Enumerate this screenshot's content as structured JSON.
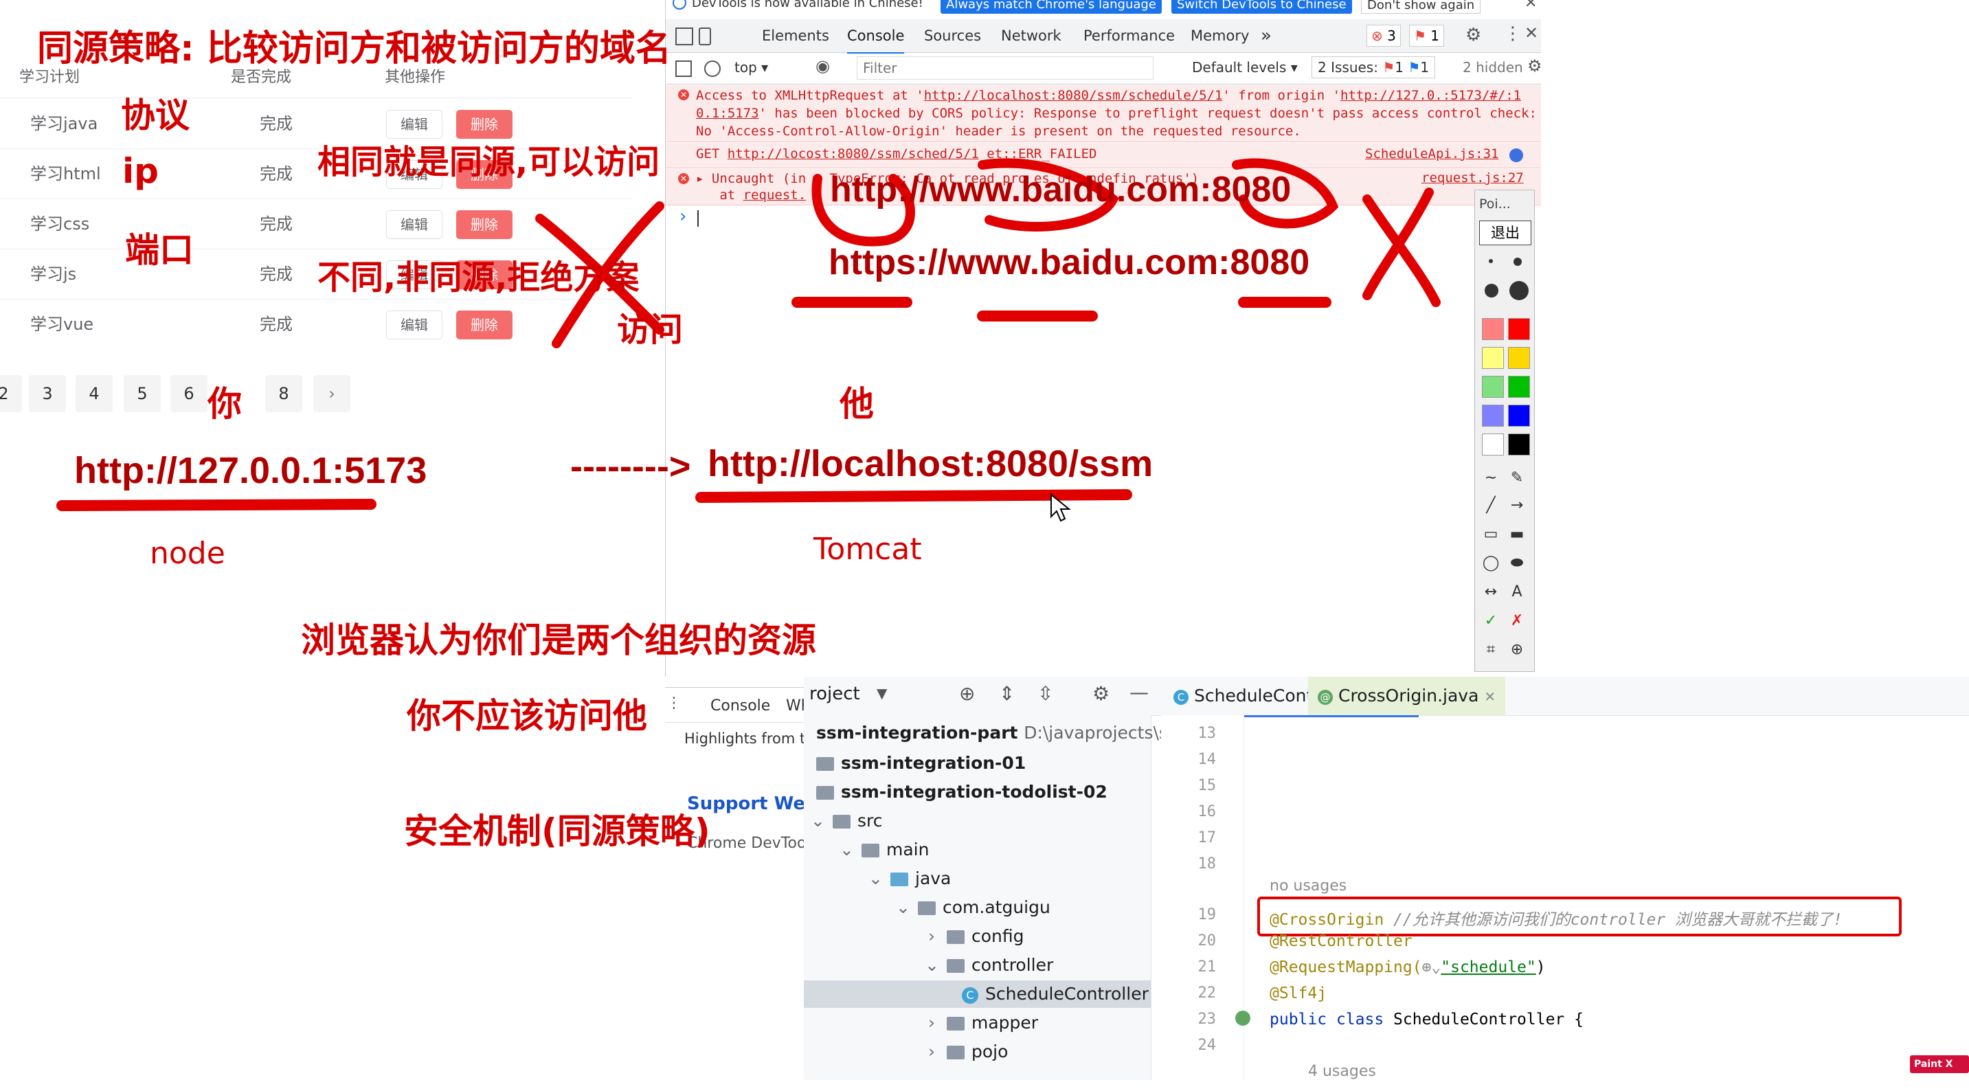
{
  "todo": {
    "headers": [
      "学习计划",
      "是否完成",
      "其他操作"
    ],
    "rows": [
      {
        "plan": "学习java",
        "status": "完成"
      },
      {
        "plan": "学习html",
        "status": "完成"
      },
      {
        "plan": "学习css",
        "status": "完成"
      },
      {
        "plan": "学习js",
        "status": "完成"
      },
      {
        "plan": "学习vue",
        "status": "完成"
      }
    ],
    "edit_label": "编辑",
    "delete_label": "删除",
    "pages": [
      "2",
      "3",
      "4",
      "5",
      "6",
      "8"
    ],
    "next_glyph": "›"
  },
  "annotations": {
    "title": "同源策略: 比较访问方和被访问方的域名",
    "protocol": "协议",
    "ip": "ip",
    "port": "端口",
    "same": "相同就是同源,可以访问",
    "diff_line1": "不同,非同源,拒绝方案",
    "diff_line2": "访问",
    "you": "你",
    "he": "他",
    "url_you": "http://127.0.0.1:5173",
    "arrow": "--------> ",
    "url_he": "http://localhost:8080/ssm",
    "node": "node",
    "tomcat": "Tomcat",
    "url_baidu_http": "http://www.baidu.com:8080",
    "url_baidu_https": "https://www.baidu.com:8080",
    "browser_thinks": "浏览器认为你们是两个组织的资源",
    "should_not": "你不应该访问他",
    "security": "安全机制(同源策略)"
  },
  "devtools": {
    "banner_text": "DevTools is now available in Chinese!",
    "banner_btn1": "Always match Chrome's language",
    "banner_btn2": "Switch DevTools to Chinese",
    "banner_btn3": "Don't show again",
    "tabs": [
      "Elements",
      "Console",
      "Sources",
      "Network",
      "Performance",
      "Memory"
    ],
    "more_tabs": "»",
    "error_count": "3",
    "warn_count": "1",
    "context": "top",
    "filter_placeholder": "Filter",
    "levels": "Default levels",
    "issues": "2 Issues:",
    "issues_err": "1",
    "issues_info": "1",
    "hidden": "2 hidden",
    "err1_pre": "Access to XMLHttpRequest at '",
    "err1_url": "http://localhost:8080/ssm/schedule/5/1",
    "err1_mid": "' from origin '",
    "err1_origin": "http://127.0.",
    "err1_origin2": ":5173/#/:1",
    "err1_line2_link": "0.1:5173",
    "err1_line2": "' has been blocked by CORS policy: Response to preflight request doesn't pass access control check:",
    "err1_line3": "No 'Access-Control-Allow-Origin' header is present on the requested resource.",
    "err2_method": "GET",
    "err2_url": "http://loc",
    "err2_url2": "ost:8080/ssm/sched",
    "err2_url3": "/5/1",
    "err2_status": "et::ERR_FAILED",
    "err2_source": "ScheduleApi.js:31",
    "err3_text": "Uncaught (in p",
    "err3_text2": "TypeError: Ca",
    "err3_text3": "ot read pro",
    "err3_text4": "es of undefin",
    "err3_text5": "ratus')",
    "err3_source": "request.js:27",
    "err3_at": "at",
    "err3_at_link": "request.",
    "prompt": "›",
    "palette_title": "Poi...",
    "palette_exit": "退出",
    "palette_colors": [
      "#ff8080",
      "#ff0000",
      "#ffff80",
      "#ffd700",
      "#80e080",
      "#00c000",
      "#8080ff",
      "#0000ff",
      "#ffffff",
      "#000000"
    ]
  },
  "drawer": {
    "tab_console": "Console",
    "tab_whats": "Wha",
    "highlights": "Highlights from the",
    "support": "Support Web",
    "chrome_devtools": "Chrome DevTool"
  },
  "ide": {
    "project_label": "roject",
    "tree": [
      {
        "label": "ssm-integration-part",
        "extra": "D:\\javaprojects\\ssm-i"
      },
      {
        "label": "ssm-integration-01"
      },
      {
        "label": "ssm-integration-todolist-02"
      },
      {
        "label": "src"
      },
      {
        "label": "main"
      },
      {
        "label": "java"
      },
      {
        "label": "com.atguigu"
      },
      {
        "label": "config"
      },
      {
        "label": "controller"
      },
      {
        "label": "ScheduleController"
      },
      {
        "label": "mapper"
      },
      {
        "label": "pojo"
      }
    ],
    "tabs": [
      "ScheduleController.java",
      "CrossOrigin.java"
    ],
    "line_numbers": [
      "13",
      "14",
      "15",
      "16",
      "17",
      "18",
      "19",
      "20",
      "21",
      "22",
      "23",
      "24"
    ],
    "no_usages": "no usages",
    "l19_anno": "@CrossOrigin",
    "l19_comment": " //允许其他源访问我们的controller 浏览器大哥就不拦截了!",
    "l20": "@RestController",
    "l21_anno": "@RequestMapping(",
    "l21_str": "\"schedule\"",
    "l21_end": ")",
    "l22": "@Slf4j",
    "l23_kw1": "public",
    "l23_kw2": " class",
    "l23_rest": " ScheduleController {",
    "usages": "4 usages",
    "watermark": "Paint X lite"
  }
}
